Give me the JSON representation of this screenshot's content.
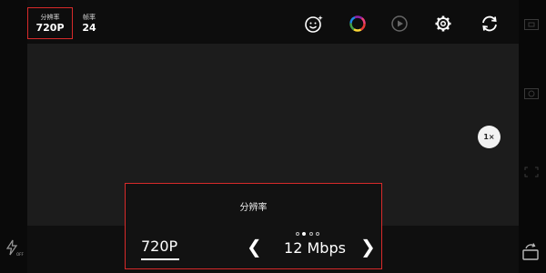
{
  "params": {
    "resolution": {
      "label": "分辨率",
      "value": "720P"
    },
    "framerate": {
      "label": "帧率",
      "value": "24"
    }
  },
  "top_icons": [
    "face-effect-icon",
    "color-filter-icon",
    "play-icon",
    "settings-icon",
    "flip-camera-icon"
  ],
  "zoom": {
    "label": "1×"
  },
  "panel": {
    "title": "分辨率",
    "resolution_value": "720P",
    "bitrate_value": "12 Mbps",
    "page_dots": {
      "count": 4,
      "active": 1
    },
    "prev_symbol": "❮",
    "next_symbol": "❯"
  },
  "flash": {
    "state_label": "OFF"
  },
  "colors": {
    "accent_red": "#d82a2a",
    "background": "#121212"
  }
}
